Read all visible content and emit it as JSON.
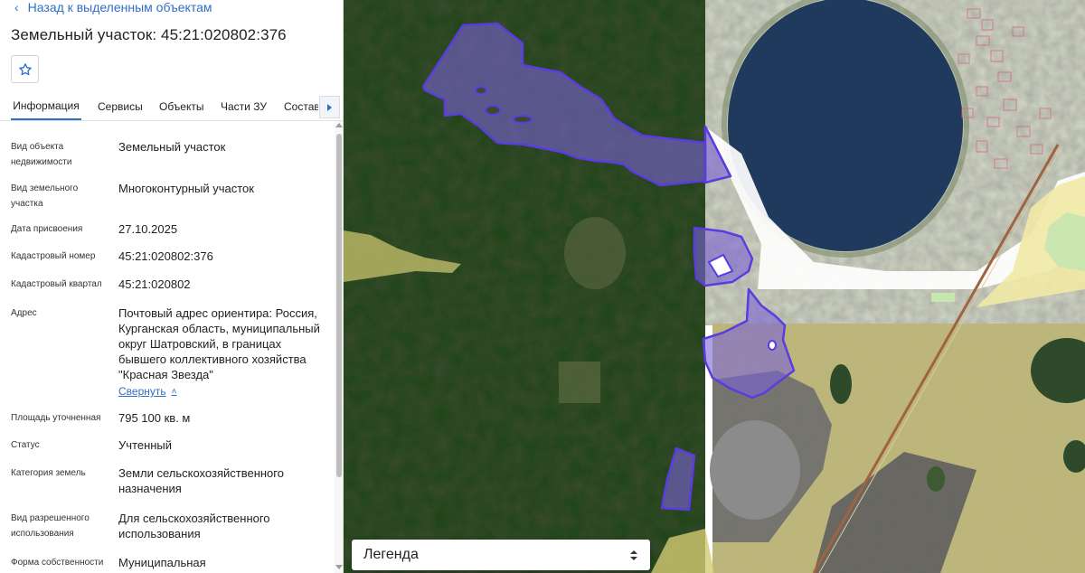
{
  "nav": {
    "back_label": "Назад к выделенным объектам"
  },
  "header": {
    "title": "Земельный участок: 45:21:020802:376"
  },
  "tabs": [
    {
      "label": "Информация",
      "active": true
    },
    {
      "label": "Сервисы",
      "active": false
    },
    {
      "label": "Объекты",
      "active": false
    },
    {
      "label": "Части ЗУ",
      "active": false
    },
    {
      "label": "Состав",
      "active": false
    }
  ],
  "properties": [
    {
      "label": "Вид объекта недвижимости",
      "value": "Земельный участок"
    },
    {
      "label": "Вид земельного участка",
      "value": "Многоконтурный участок"
    },
    {
      "label": "Дата присвоения",
      "value": "27.10.2025"
    },
    {
      "label": "Кадастровый номер",
      "value": "45:21:020802:376"
    },
    {
      "label": "Кадастровый квартал",
      "value": "45:21:020802"
    },
    {
      "label": "Адрес",
      "value": "Почтовый адрес ориентира: Россия, Курганская область, муниципальный округ Шатровский, в границах бывшего коллективного хозяйства \"Красная Звезда\""
    },
    {
      "label": "Площадь уточненная",
      "value": "795 100 кв. м"
    },
    {
      "label": "Статус",
      "value": "Учтенный"
    },
    {
      "label": "Категория земель",
      "value": "Земли сельскохозяйственного назначения"
    },
    {
      "label": "Вид разрешенного использования",
      "value": "Для сельскохозяйственного использования"
    },
    {
      "label": "Форма собственности",
      "value": "Муниципальная"
    }
  ],
  "address_collapse_label": "Свернуть",
  "legend": {
    "title": "Легенда"
  },
  "colors": {
    "accent": "#2f6fc4",
    "parcel_fill": "#7a63d6",
    "parcel_stroke": "#5a3ce0",
    "zone_fill": "#e8dc8a"
  },
  "icons": {
    "back": "chevron-left-icon",
    "favorite": "star-icon",
    "tabs_scroll": "chevron-right-icon",
    "collapse": "chevron-up-icon",
    "legend_toggle": "up-down-arrows-icon"
  }
}
